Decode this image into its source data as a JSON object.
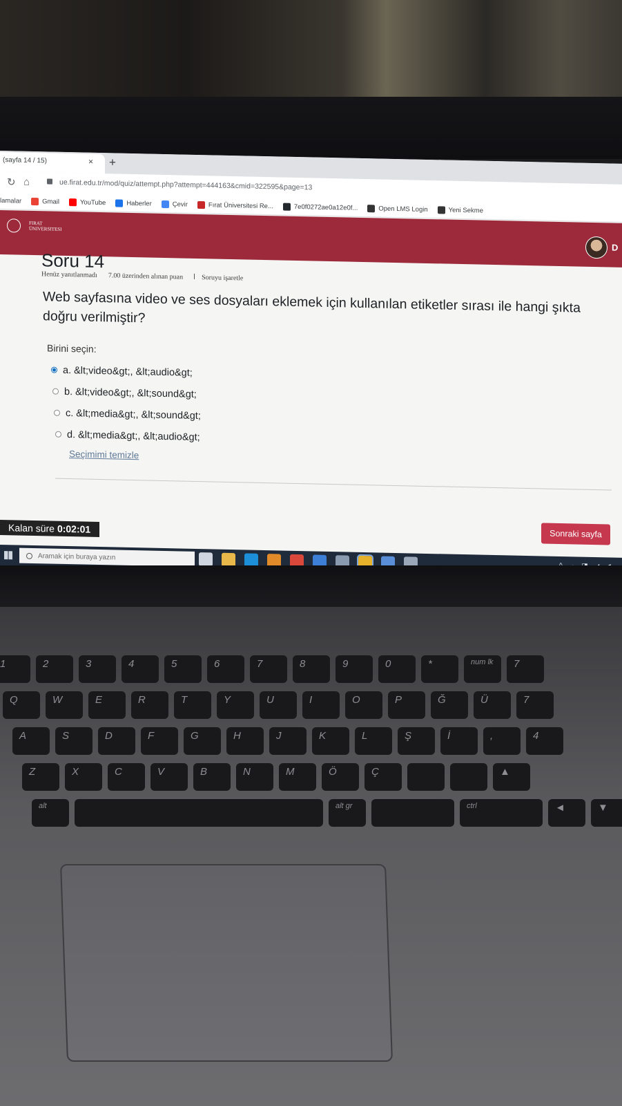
{
  "browser": {
    "tab_title": "(sayfa 14 / 15)",
    "tab_close": "×",
    "new_tab": "+",
    "url": "ue.firat.edu.tr/mod/quiz/attempt.php?attempt=444163&cmid=322595&page=13",
    "bookmarks": [
      {
        "label": "lamalar",
        "icon_color": ""
      },
      {
        "label": "Gmail",
        "icon_color": "#ea4335"
      },
      {
        "label": "YouTube",
        "icon_color": "#ff0000"
      },
      {
        "label": "Haberler",
        "icon_color": "#1a73e8"
      },
      {
        "label": "Çevir",
        "icon_color": "#4285f4"
      },
      {
        "label": "Fırat Üniversitesi Re...",
        "icon_color": "#c62828"
      },
      {
        "label": "7e0f0272ae0a12e0f...",
        "icon_color": "#24292e"
      },
      {
        "label": "Open LMS Login",
        "icon_color": "#333333"
      },
      {
        "label": "Yeni Sekme",
        "icon_color": "#333333"
      }
    ]
  },
  "site": {
    "logo_line1": "FIRAT",
    "logo_line2": "ÜNIVERSITESI",
    "user_initial": "D",
    "brand_color": "#9c2a3a"
  },
  "question": {
    "title": "Soru 14",
    "status": "Henüz yanıtlanmadı",
    "points": "7.00 üzerinden alınan puan",
    "flag": "Soruyu işaretle",
    "text": "Web sayfasına video ve ses dosyaları eklemek için kullanılan etiketler sırası ile hangi şıkta doğru verilmiştir?",
    "prompt": "Birini seçin:",
    "options": [
      {
        "label": "a. &lt;video&gt;, &lt;audio&gt;",
        "selected": true
      },
      {
        "label": "b. &lt;video&gt;, &lt;sound&gt;",
        "selected": false
      },
      {
        "label": "c. &lt;media&gt;, &lt;sound&gt;",
        "selected": false
      },
      {
        "label": "d. &lt;media&gt;, &lt;audio&gt;",
        "selected": false
      }
    ],
    "clear_link": "Seçimimi temizle"
  },
  "navigation": {
    "next_button": "Sonraki sayfa"
  },
  "timer": {
    "label": "Kalan süre",
    "value": "0:02:01"
  },
  "taskbar": {
    "search_placeholder": "Aramak için buraya yazın",
    "app_icons": [
      "task-view-icon",
      "file-explorer-icon",
      "edge-icon",
      "store-icon",
      "office-icon",
      "mail-icon",
      "app-icon",
      "chrome-icon",
      "app-icon-2",
      "app-icon-3"
    ],
    "app_colors": [
      "#cfd6df",
      "#e8b84a",
      "#1d8fd8",
      "#e08a2a",
      "#d9483b",
      "#3d7fd6",
      "#8a9bb0",
      "#e6b12b",
      "#5a8fd8",
      "#9aa8ba"
    ],
    "tray": "^ ☁ ◨ ◢ ◀"
  },
  "keyboard": {
    "row1": [
      "1",
      "2",
      "3",
      "4",
      "5",
      "6",
      "7",
      "8",
      "9",
      "0",
      "*",
      "num lk",
      "7"
    ],
    "row2": [
      "Q",
      "W",
      "E",
      "R",
      "T",
      "Y",
      "U",
      "I",
      "O",
      "P",
      "Ğ",
      "Ü",
      "7"
    ],
    "row3": [
      "A",
      "S",
      "D",
      "F",
      "G",
      "H",
      "J",
      "K",
      "L",
      "Ş",
      "İ",
      ",",
      "4"
    ],
    "row4": [
      "Z",
      "X",
      "C",
      "V",
      "B",
      "N",
      "M",
      "Ö",
      "Ç",
      "",
      "",
      "▲"
    ],
    "row5": [
      "alt",
      "",
      "alt gr",
      "",
      "ctrl",
      "◄",
      "▼"
    ]
  }
}
